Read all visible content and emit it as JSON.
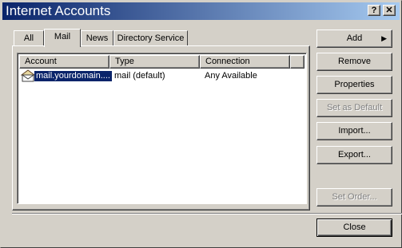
{
  "window": {
    "title": "Internet Accounts"
  },
  "titlebar_buttons": {
    "help": "?",
    "close": "✕"
  },
  "tabs": [
    {
      "label": "All",
      "active": false
    },
    {
      "label": "Mail",
      "active": true
    },
    {
      "label": "News",
      "active": false
    },
    {
      "label": "Directory Service",
      "active": false
    }
  ],
  "list": {
    "columns": [
      "Account",
      "Type",
      "Connection"
    ],
    "rows": [
      {
        "account": "mail.yourdomain....",
        "type": "mail (default)",
        "connection": "Any Available",
        "selected": true,
        "icon": "mail-account-icon"
      }
    ]
  },
  "buttons": {
    "add": "Add",
    "remove": "Remove",
    "properties": "Properties",
    "set_default": "Set as Default",
    "import": "Import...",
    "export": "Export...",
    "set_order": "Set Order...",
    "close": "Close"
  },
  "colors": {
    "title_start": "#0a246a",
    "title_end": "#a6caf0",
    "face": "#d4d0c8",
    "selection": "#0a246a"
  }
}
